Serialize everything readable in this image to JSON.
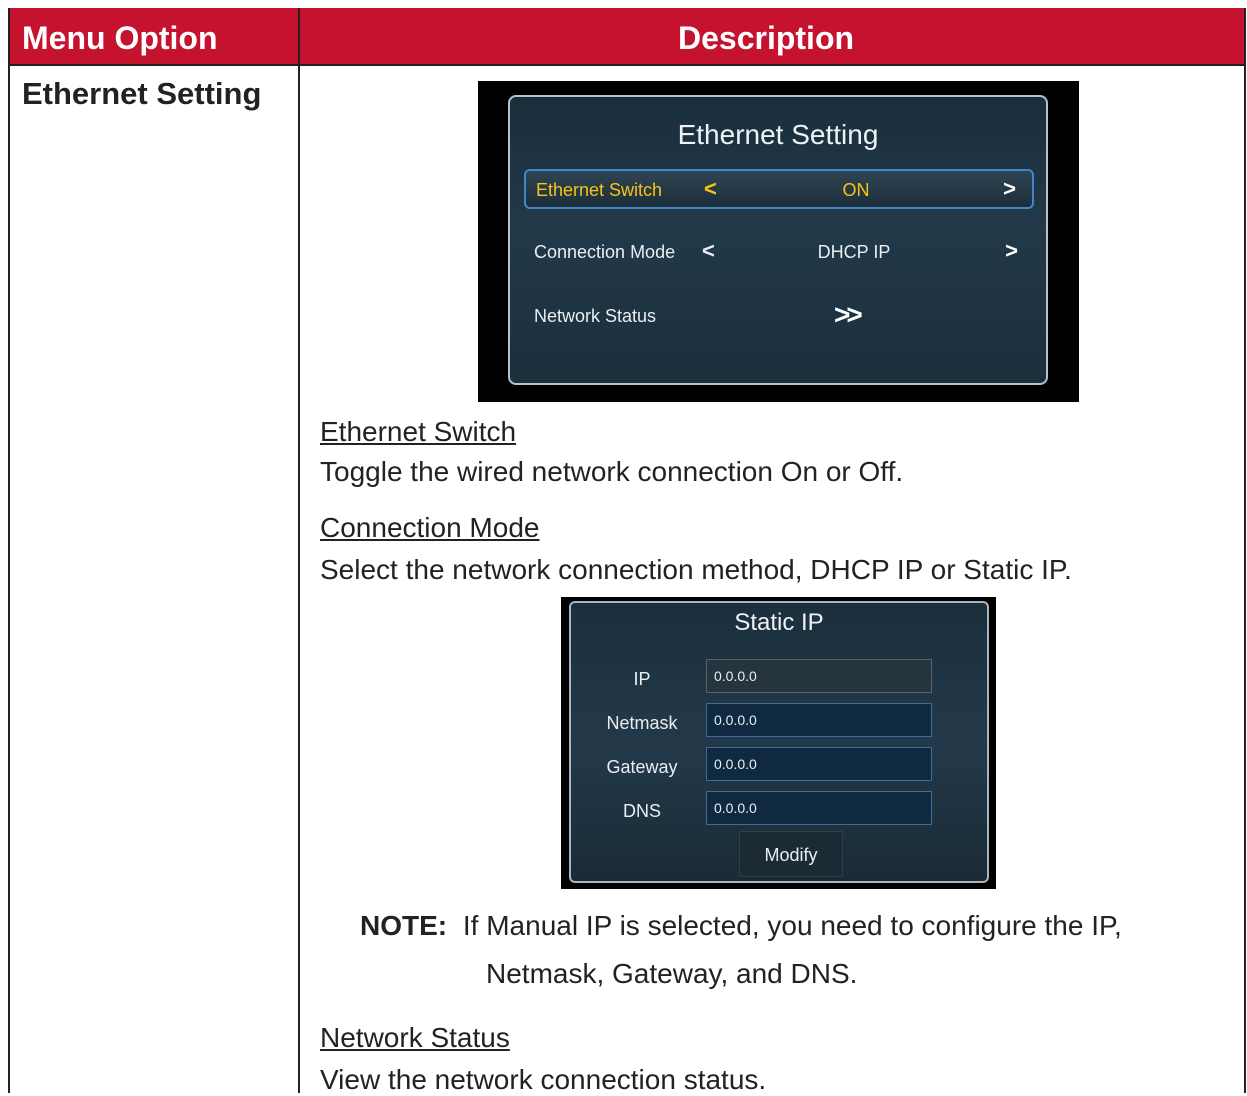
{
  "table": {
    "col1_header": "Menu Option",
    "col2_header": "Description",
    "row_label": "Ethernet Setting"
  },
  "ethernet_screen": {
    "title": "Ethernet Setting",
    "rows": [
      {
        "label": "Ethernet Switch",
        "left_arrow": "<",
        "value": "ON",
        "right_arrow": ">"
      },
      {
        "label": "Connection Mode",
        "left_arrow": "<",
        "value": "DHCP IP",
        "right_arrow": ">"
      },
      {
        "label": "Network Status",
        "action": ">>"
      }
    ],
    "colors": {
      "selected_text": "#f5c518",
      "selected_border": "#3f88c5"
    }
  },
  "sections": {
    "ethernet_switch_heading": "Ethernet Switch",
    "ethernet_switch_desc": "Toggle the wired network connection On or Off.",
    "connection_mode_heading": "Connection Mode",
    "connection_mode_desc": "Select the network connection method, DHCP IP or Static IP.",
    "note_label": "NOTE:",
    "note_line1": "If Manual IP is selected, you need to configure the IP,",
    "note_line2": "Netmask, Gateway, and DNS.",
    "network_status_heading": "Network Status",
    "network_status_desc": "View the network connection status."
  },
  "static_ip_screen": {
    "title": "Static IP",
    "fields": [
      {
        "label": "IP",
        "value": "0.0.0.0"
      },
      {
        "label": "Netmask",
        "value": "0.0.0.0"
      },
      {
        "label": "Gateway",
        "value": "0.0.0.0"
      },
      {
        "label": "DNS",
        "value": "0.0.0.0"
      }
    ],
    "button": "Modify"
  },
  "colors": {
    "header_bg": "#c4122f",
    "header_text": "#ffffff"
  }
}
